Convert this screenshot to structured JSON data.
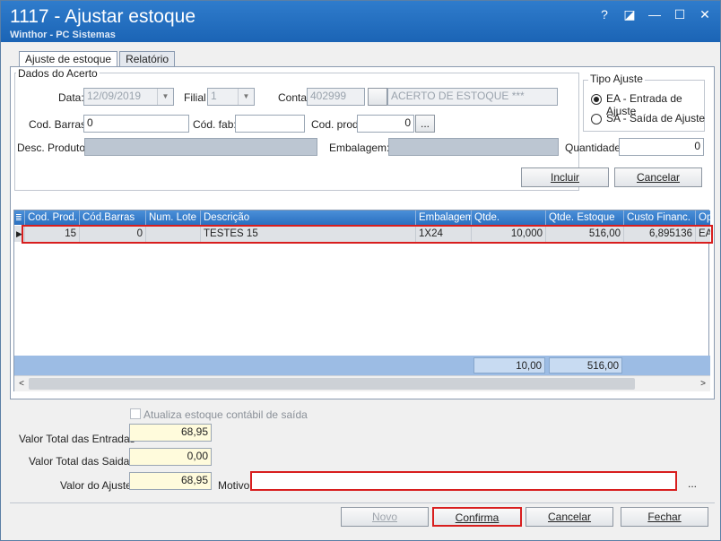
{
  "window": {
    "title": "1117 - Ajustar estoque",
    "subtitle": "Winthor - PC Sistemas",
    "help_label": "?",
    "restore_label": "◪",
    "minimize_label": "—",
    "maximize_label": "☐",
    "close_label": "✕"
  },
  "tabs": [
    {
      "label": "Ajuste de estoque",
      "active": true
    },
    {
      "label": "Relatório",
      "active": false
    }
  ],
  "dados": {
    "group_title": "Dados do Acerto",
    "data_label": "Data:",
    "data_value": "12/09/2019",
    "filial_label": "Filial",
    "filial_value": "1",
    "conta_label": "Conta",
    "conta_value": "402999",
    "conta_button": "...",
    "conta_desc": "ACERTO DE ESTOQUE ***",
    "cod_barras_label": "Cod. Barras:",
    "cod_barras_value": "0",
    "cod_fab_label": "Cód. fab:",
    "cod_fab_value": "",
    "cod_prod_label": "Cod. prod",
    "cod_prod_value": "0",
    "cod_prod_button": "...",
    "desc_produto_label": "Desc. Produto:",
    "embalagem_label": "Embalagem:",
    "quantidade_label": "Quantidade",
    "quantidade_value": "0"
  },
  "tipo_ajuste": {
    "title": "Tipo Ajuste",
    "options": [
      {
        "label": "EA - Entrada de Ajuste",
        "selected": true
      },
      {
        "label": "SA - Saída de Ajuste",
        "selected": false
      }
    ]
  },
  "buttons": {
    "incluir": "Incluir",
    "cancelar_top": "Cancelar",
    "novo": "Novo",
    "confirma": "Confirma",
    "cancelar": "Cancelar",
    "fechar": "Fechar",
    "motivo_more": "..."
  },
  "grid": {
    "columns": [
      "Cod. Prod.",
      "Cód.Barras",
      "Num. Lote",
      "Descrição",
      "Embalagem",
      "Qtde.",
      "Qtde. Estoque",
      "Custo Financ.",
      "Op"
    ],
    "rows": [
      [
        "15",
        "0",
        "",
        "TESTES 15",
        "1X24",
        "10,000",
        "516,00",
        "6,895136",
        "EA"
      ]
    ],
    "totals": {
      "qtde": "10,00",
      "qtde_estoque": "516,00"
    }
  },
  "summary": {
    "atualiza_label": "Atualiza estoque contábil de saída",
    "atualiza_checked": false,
    "valor_entradas_label": "Valor Total das Entradas",
    "valor_entradas": "68,95",
    "valor_saidas_label": "Valor Total das Saidas",
    "valor_saidas": "0,00",
    "valor_ajuste_label": "Valor do Ajuste",
    "valor_ajuste": "68,95",
    "motivo_label": "Motivo",
    "motivo_value": ""
  },
  "colors": {
    "title_bar": "#1b64b5",
    "grid_header": "#2a70c0",
    "highlight": "#d81e1e"
  }
}
